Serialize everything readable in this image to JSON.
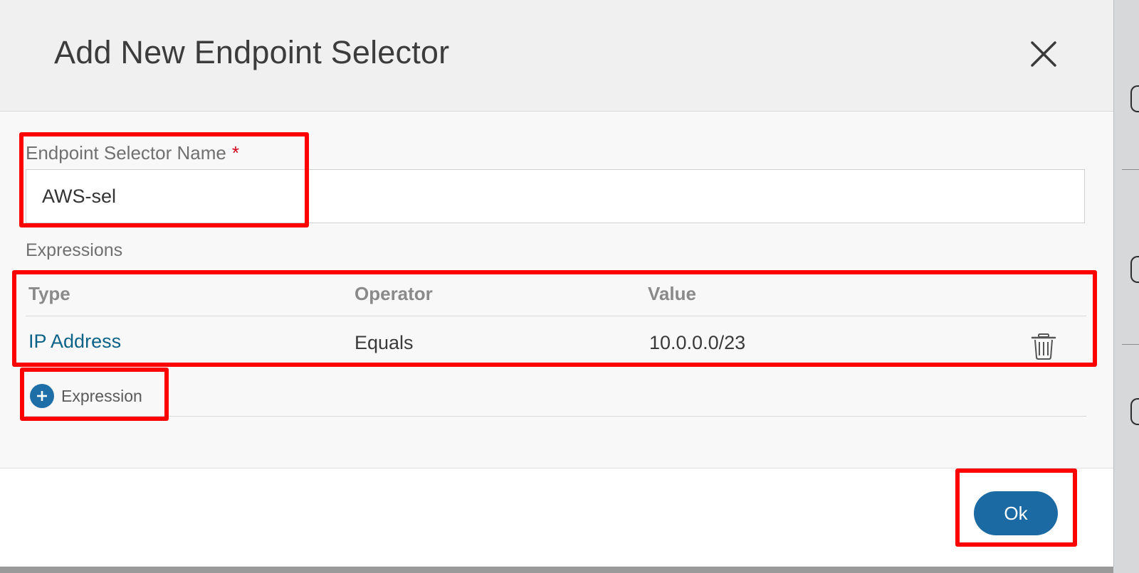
{
  "dialog": {
    "title": "Add New Endpoint Selector",
    "close_icon": "close-icon"
  },
  "name_field": {
    "label": "Endpoint Selector Name",
    "required_mark": "*",
    "value": "AWS-sel",
    "placeholder": ""
  },
  "expressions": {
    "section_label": "Expressions",
    "columns": [
      "Type",
      "Operator",
      "Value"
    ],
    "rows": [
      {
        "type": "IP Address",
        "operator": "Equals",
        "value": "10.0.0.0/23",
        "delete_icon": "trash-icon"
      }
    ],
    "add_label": "Expression",
    "add_icon": "plus-circle-icon"
  },
  "footer": {
    "ok_label": "Ok"
  },
  "colors": {
    "accent": "#1b6aa3",
    "link": "#0d6288",
    "required": "#d0021b",
    "highlight": "#ff0000"
  }
}
